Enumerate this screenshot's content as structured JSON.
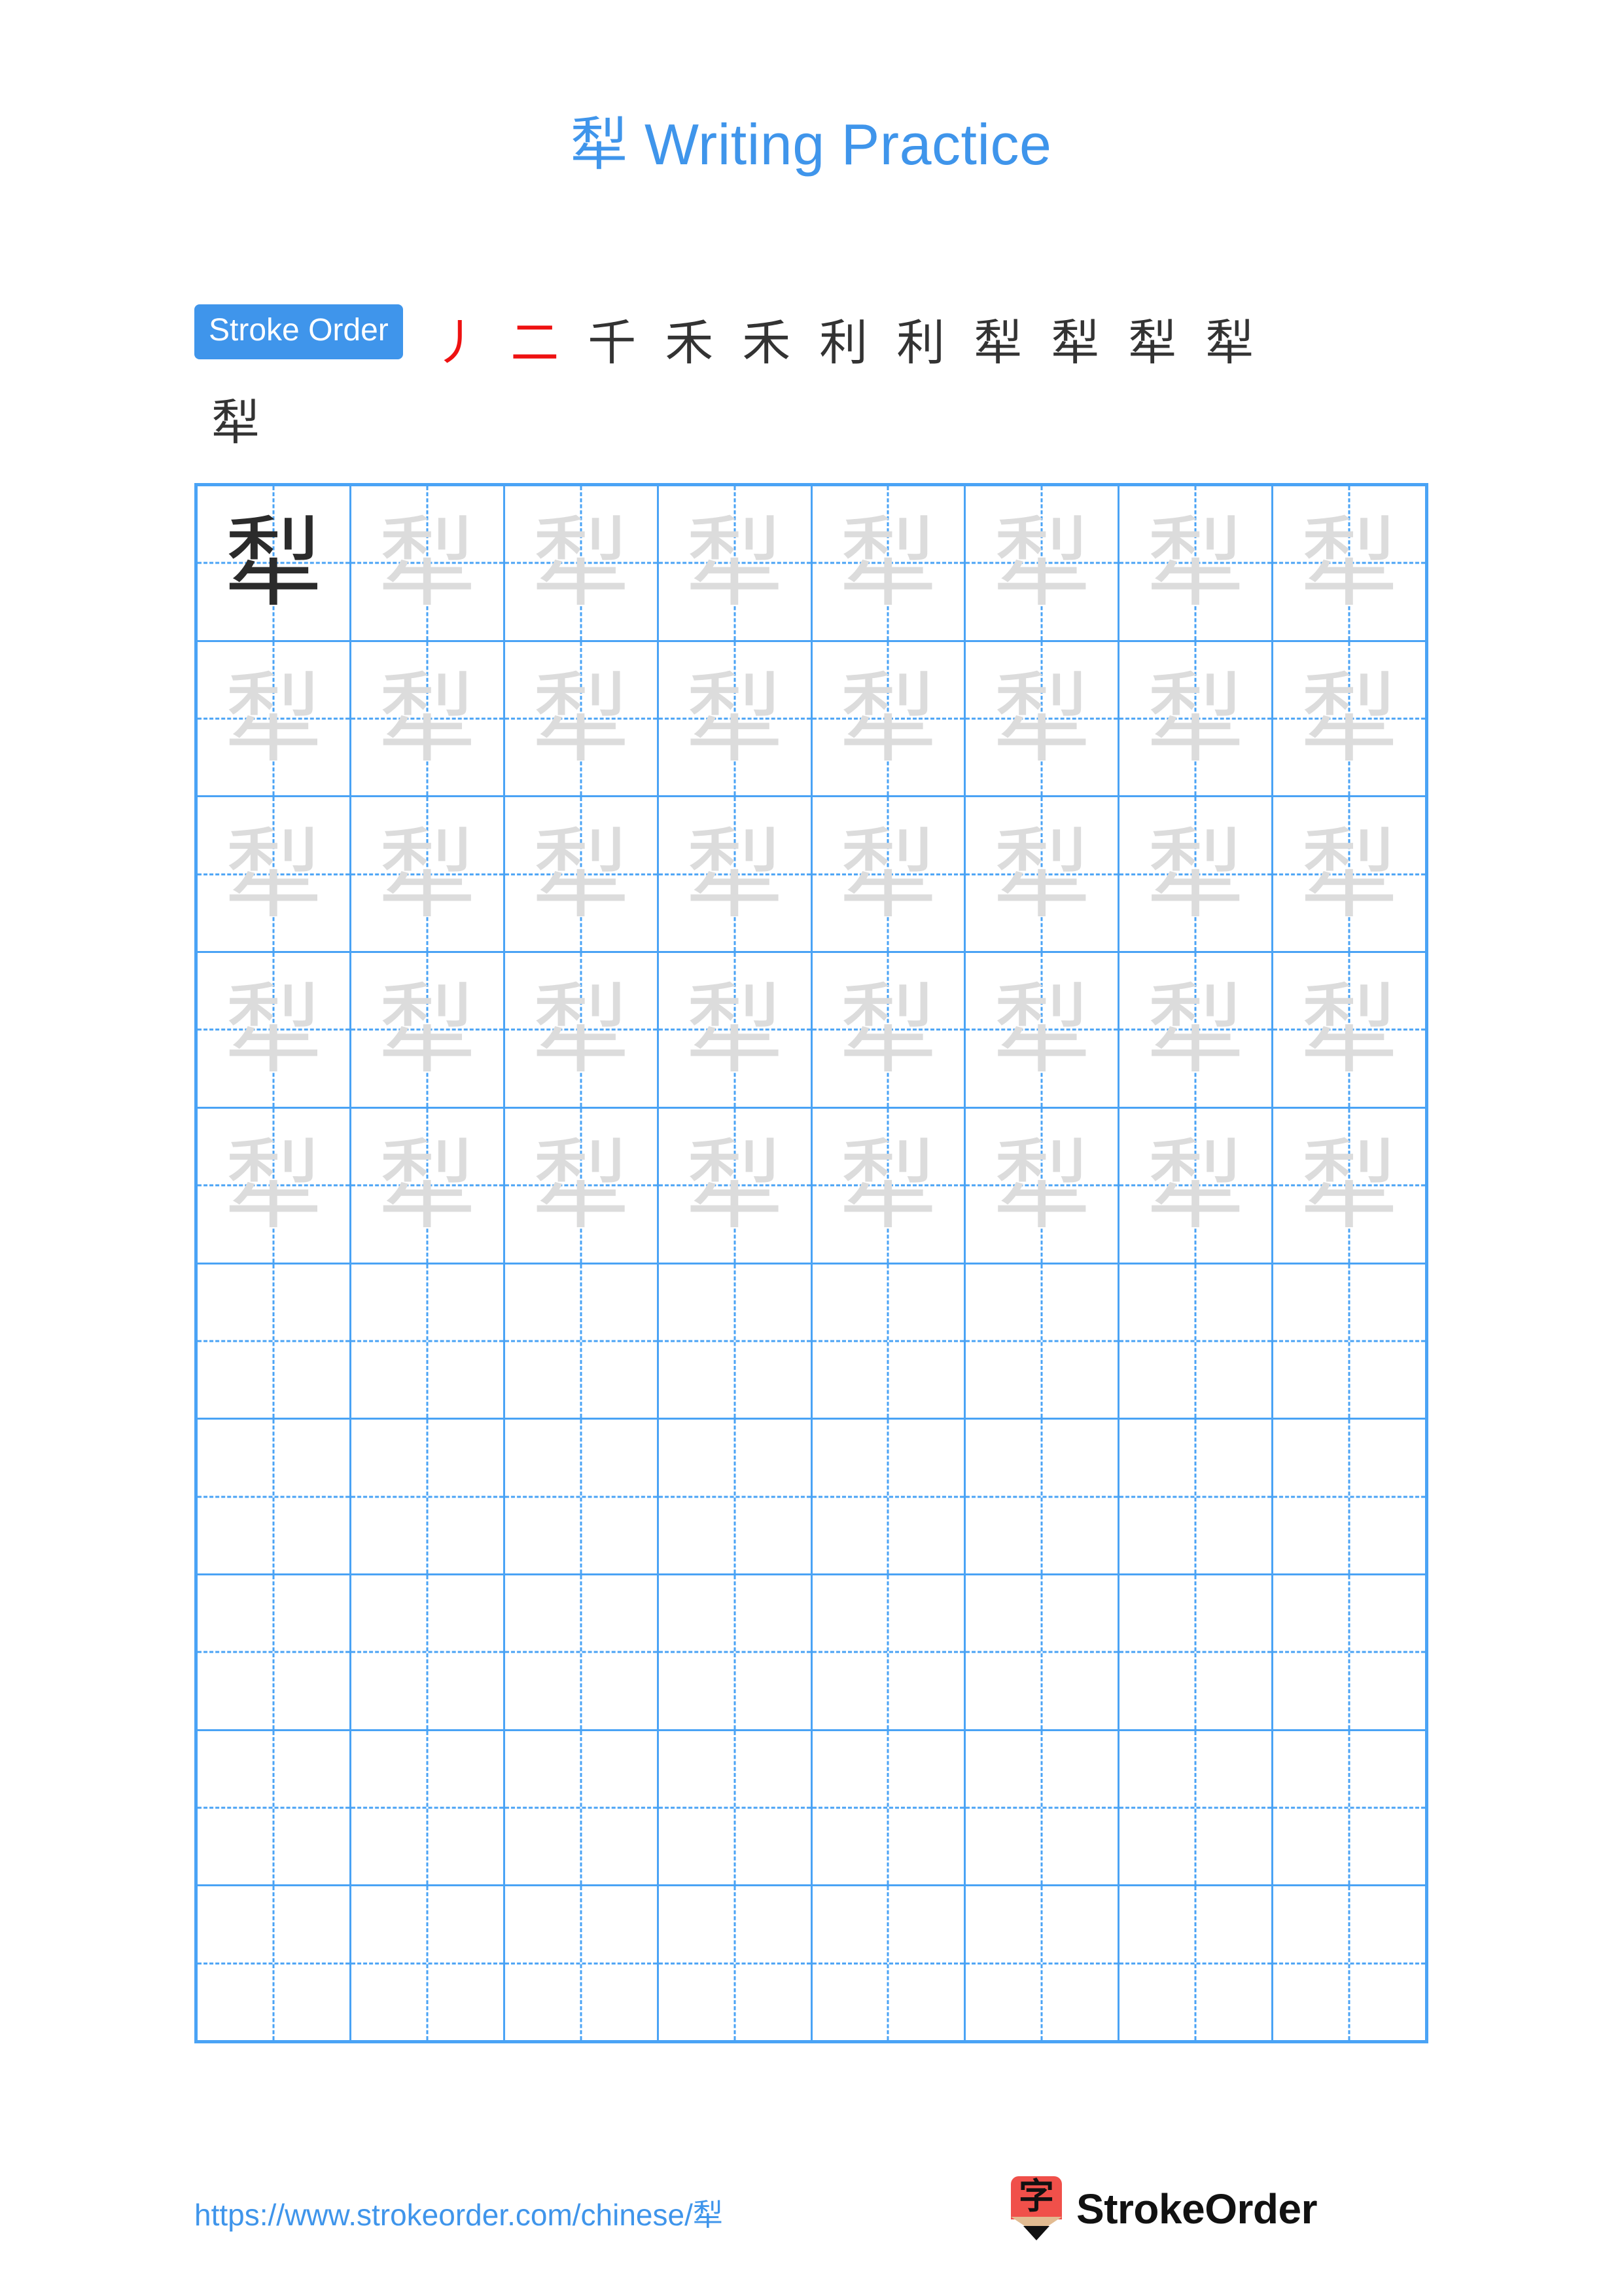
{
  "character": "犁",
  "title": {
    "char": "犁",
    "text": " Writing Practice",
    "full": "犁 Writing Practice",
    "color": "#3f95eb"
  },
  "stroke_order": {
    "badge_label": "Stroke Order",
    "badge_bg": "#3f95eb",
    "badge_text_color": "#ffffff",
    "total_strokes": 12,
    "previous_stroke_color": "#333333",
    "new_stroke_color": "#ee1111",
    "steps_row1": [
      {
        "index": 1,
        "glyph": "丿"
      },
      {
        "index": 2,
        "glyph": "二"
      },
      {
        "index": 3,
        "glyph": "千"
      },
      {
        "index": 4,
        "glyph": "禾"
      },
      {
        "index": 5,
        "glyph": "禾"
      },
      {
        "index": 6,
        "glyph": "利"
      },
      {
        "index": 7,
        "glyph": "利"
      },
      {
        "index": 8,
        "glyph": "犁"
      },
      {
        "index": 9,
        "glyph": "犁"
      },
      {
        "index": 10,
        "glyph": "犁"
      },
      {
        "index": 11,
        "glyph": "犁"
      }
    ],
    "steps_row2": [
      {
        "index": 12,
        "glyph": "犁"
      }
    ]
  },
  "practice_grid": {
    "columns": 8,
    "rows": 10,
    "border_color": "#4aa3f5",
    "guide_color": "#4aa3f5",
    "model_char_color": "#2b2b2b",
    "trace_char_color": "#dcdcdc",
    "filled_rows": 5,
    "empty_rows": 5,
    "model_cell": {
      "row": 1,
      "column": 1,
      "char": "犁"
    },
    "trace_char": "犁"
  },
  "footer": {
    "url": "https://www.strokeorder.com/chinese/犁",
    "url_color": "#3f95eb",
    "brand_name": "StrokeOrder",
    "logo_char": "字",
    "logo_body_color": "#f0504a",
    "logo_wood_color": "#e2bb91",
    "logo_tip_color": "#111111"
  }
}
